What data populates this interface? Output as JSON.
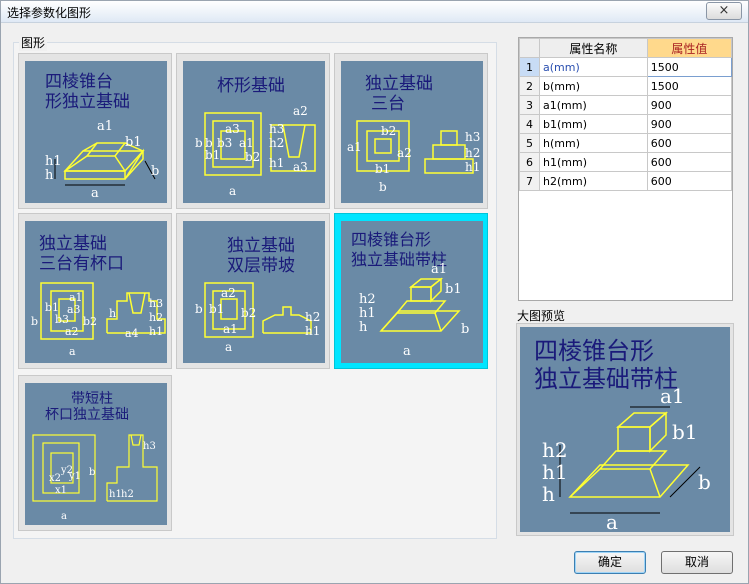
{
  "window": {
    "title": "选择参数化图形",
    "close_label": "×"
  },
  "graphics_group": {
    "label": "图形"
  },
  "thumbnails": [
    {
      "title1": "四棱锥台",
      "title2": "形独立基础",
      "labels": [
        "a1",
        "b1",
        "h1",
        "h",
        "a",
        "b"
      ]
    },
    {
      "title1": "杯形基础",
      "title2": "",
      "labels": [
        "a2",
        "a3",
        "h3",
        "b",
        "b3",
        "a1",
        "h2",
        "b",
        "b1",
        "b2",
        "h1",
        "a3",
        "a"
      ]
    },
    {
      "title1": "独立基础",
      "title2": "三台",
      "labels": [
        "b2",
        "a1",
        "a2",
        "h3",
        "h2",
        "h1",
        "b1",
        "b"
      ]
    },
    {
      "title1": "独立基础",
      "title2": "三台有杯口",
      "labels": [
        "a1",
        "b1",
        "a3",
        "b3",
        "a2",
        "b2",
        "a4",
        "h3",
        "h2",
        "h1",
        "a",
        "b",
        "h"
      ]
    },
    {
      "title1": "独立基础",
      "title2": "双层带坡",
      "labels": [
        "a2",
        "b",
        "b1",
        "b2",
        "a1",
        "a",
        "h2",
        "h1"
      ]
    },
    {
      "title1": "四棱锥台形",
      "title2": "独立基础带柱",
      "labels": [
        "a1",
        "b1",
        "h2",
        "h1",
        "h",
        "a",
        "b"
      ]
    },
    {
      "title1": "带短柱",
      "title2": "杯口独立基础",
      "labels": [
        "x2",
        "y2",
        "y1",
        "x1",
        "b",
        "a",
        "h3",
        "h1",
        "h2"
      ]
    }
  ],
  "properties": {
    "col_num": "",
    "col_name": "属性名称",
    "col_value": "属性值",
    "rows": [
      {
        "num": "1",
        "name": "a(mm)",
        "value": "1500"
      },
      {
        "num": "2",
        "name": "b(mm)",
        "value": "1500"
      },
      {
        "num": "3",
        "name": "a1(mm)",
        "value": "900"
      },
      {
        "num": "4",
        "name": "b1(mm)",
        "value": "900"
      },
      {
        "num": "5",
        "name": "h(mm)",
        "value": "600"
      },
      {
        "num": "6",
        "name": "h1(mm)",
        "value": "600"
      },
      {
        "num": "7",
        "name": "h2(mm)",
        "value": "600"
      }
    ]
  },
  "preview": {
    "label": "大图预览",
    "title1": "四棱锥台形",
    "title2": "独立基础带柱",
    "labels": [
      "a1",
      "b1",
      "h2",
      "h1",
      "h",
      "a",
      "b"
    ]
  },
  "buttons": {
    "ok": "确定",
    "cancel": "取消"
  },
  "colors": {
    "thumb_bg": "#6a8aa6",
    "drawing": "#ffff33",
    "title_text": "#1a1a7a",
    "selected_border": "#00e5ff"
  }
}
